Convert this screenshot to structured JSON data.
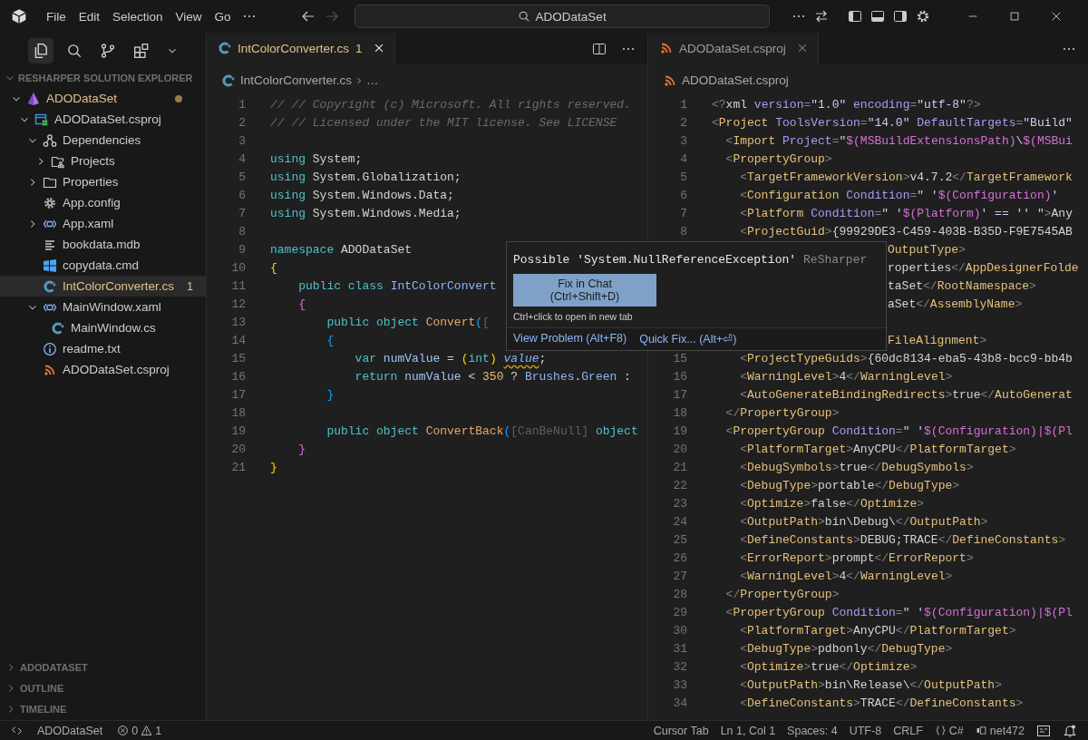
{
  "title_bar": {
    "menus": [
      "File",
      "Edit",
      "Selection",
      "View",
      "Go"
    ],
    "search": "ADODataSet"
  },
  "sidebar": {
    "views": [
      {
        "kind": "explorer",
        "selected": true
      },
      {
        "kind": "search",
        "selected": false
      },
      {
        "kind": "source-control",
        "selected": false
      },
      {
        "kind": "extensions",
        "selected": false
      }
    ],
    "title": "RESHARPER SOLUTION EXPLORER",
    "tree": [
      {
        "label": "ADODataSet",
        "kind": "solution",
        "expanded": true,
        "warning": true,
        "modified": true,
        "selected": false,
        "children": [
          {
            "label": "ADODataSet.csproj",
            "kind": "csproj",
            "expanded": true,
            "warning": false,
            "selected": false,
            "children": [
              {
                "label": "Dependencies",
                "kind": "deps",
                "expanded": true,
                "warning": false,
                "selected": false,
                "children": [
                  {
                    "label": "Projects",
                    "kind": "projects",
                    "expanded": false,
                    "warning": false,
                    "selected": false
                  }
                ]
              },
              {
                "label": "Properties",
                "kind": "folder",
                "expanded": false,
                "warning": false,
                "selected": false
              },
              {
                "label": "App.config",
                "kind": "gear",
                "warning": false,
                "selected": false
              },
              {
                "label": "App.xaml",
                "kind": "xaml",
                "expanded": false,
                "warning": false,
                "selected": false
              },
              {
                "label": "bookdata.mdb",
                "kind": "lines",
                "warning": false,
                "selected": false
              },
              {
                "label": "copydata.cmd",
                "kind": "windows",
                "warning": false,
                "selected": false
              },
              {
                "label": "IntColorConverter.cs",
                "kind": "cs",
                "warning": true,
                "badge": "1",
                "selected": true
              },
              {
                "label": "MainWindow.xaml",
                "kind": "xaml",
                "expanded": true,
                "warning": false,
                "selected": false,
                "children": [
                  {
                    "label": "MainWindow.cs",
                    "kind": "cs",
                    "warning": false,
                    "selected": false
                  }
                ]
              },
              {
                "label": "readme.txt",
                "kind": "info",
                "warning": false,
                "selected": false
              },
              {
                "label": "ADODataSet.csproj",
                "kind": "rss",
                "warning": false,
                "selected": false
              }
            ]
          }
        ]
      }
    ],
    "panels": [
      {
        "title": "ADODATASET",
        "expanded": false
      },
      {
        "title": "OUTLINE",
        "expanded": false
      },
      {
        "title": "TIMELINE",
        "expanded": false
      }
    ]
  },
  "editors": [
    {
      "focused": true,
      "tabs": [
        {
          "label": "IntColorConverter.cs",
          "kind": "cs",
          "badge": "1",
          "warning": true,
          "selected": true
        }
      ],
      "breadcrumb": {
        "kind": "cs",
        "parts": [
          "IntColorConverter.cs",
          "…"
        ]
      },
      "lines": [
        {
          "number": "1",
          "tokens": [
            {
              "kind": "comment",
              "text": "// // Copyright (c) Microsoft. All rights reserved."
            }
          ]
        },
        {
          "number": "2",
          "tokens": [
            {
              "kind": "comment",
              "text": "// // Licensed under the MIT license. See LICENSE"
            }
          ]
        },
        {
          "number": "3"
        },
        {
          "number": "4",
          "tokens": [
            {
              "kind": "kw",
              "text": "using"
            },
            {
              "kind": "text",
              "text": " System;"
            }
          ]
        },
        {
          "number": "5",
          "tokens": [
            {
              "kind": "kw",
              "text": "using"
            },
            {
              "kind": "text",
              "text": " System.Globalization;"
            }
          ]
        },
        {
          "number": "6",
          "tokens": [
            {
              "kind": "kw",
              "text": "using"
            },
            {
              "kind": "text",
              "text": " System.Windows.Data;"
            }
          ]
        },
        {
          "number": "7",
          "tokens": [
            {
              "kind": "kw",
              "text": "using"
            },
            {
              "kind": "text",
              "text": " System.Windows.Media;"
            }
          ]
        },
        {
          "number": "8"
        },
        {
          "number": "9",
          "tokens": [
            {
              "kind": "kw",
              "text": "namespace"
            },
            {
              "kind": "text",
              "text": " ADODataSet"
            }
          ]
        },
        {
          "number": "10",
          "tokens": [
            {
              "kind": "brace1",
              "text": "{"
            }
          ]
        },
        {
          "number": "11",
          "tokens": [
            {
              "kind": "kw",
              "text": "    public class "
            },
            {
              "kind": "type",
              "text": "IntColorConvert"
            }
          ]
        },
        {
          "number": "12",
          "tokens": [
            {
              "kind": "brace2",
              "text": "    {"
            }
          ]
        },
        {
          "number": "13",
          "tokens": [
            {
              "kind": "kw",
              "text": "        public object "
            },
            {
              "kind": "method",
              "text": "Convert"
            },
            {
              "kind": "brace3",
              "text": "("
            },
            {
              "kind": "attr",
              "text": "["
            }
          ]
        },
        {
          "number": "14",
          "tokens": [
            {
              "kind": "brace3",
              "text": "        {"
            }
          ]
        },
        {
          "number": "15",
          "tokens": [
            {
              "kind": "kw",
              "text": "            var "
            },
            {
              "kind": "ident",
              "text": "numValue"
            },
            {
              "kind": "text",
              "text": " = "
            },
            {
              "kind": "brace1",
              "text": "("
            },
            {
              "kind": "kw",
              "text": "int"
            },
            {
              "kind": "brace1",
              "text": ") "
            },
            {
              "kind": "warn",
              "text": "value"
            },
            {
              "kind": "text",
              "text": ";"
            }
          ]
        },
        {
          "number": "16",
          "tokens": [
            {
              "kind": "kw",
              "text": "            return "
            },
            {
              "kind": "ident",
              "text": "numValue"
            },
            {
              "kind": "text",
              "text": " < "
            },
            {
              "kind": "num",
              "text": "350"
            },
            {
              "kind": "text",
              "text": " ? "
            },
            {
              "kind": "type",
              "text": "Brushes"
            },
            {
              "kind": "text",
              "text": "."
            },
            {
              "kind": "type",
              "text": "Green"
            },
            {
              "kind": "text",
              "text": " :"
            }
          ]
        },
        {
          "number": "17",
          "tokens": [
            {
              "kind": "brace3",
              "text": "        }"
            }
          ]
        },
        {
          "number": "18"
        },
        {
          "number": "19",
          "tokens": [
            {
              "kind": "kw",
              "text": "        public object "
            },
            {
              "kind": "method",
              "text": "ConvertBack"
            },
            {
              "kind": "brace3",
              "text": "("
            },
            {
              "kind": "attr",
              "text": "[CanBeNull]"
            },
            {
              "kind": "kw",
              "text": " object"
            }
          ]
        },
        {
          "number": "20",
          "tokens": [
            {
              "kind": "brace2",
              "text": "    }"
            }
          ]
        },
        {
          "number": "21",
          "tokens": [
            {
              "kind": "brace1",
              "text": "}"
            }
          ]
        }
      ]
    },
    {
      "focused": false,
      "tabs": [
        {
          "label": "ADODataSet.csproj",
          "kind": "rss",
          "warning": false,
          "selected": true
        }
      ],
      "breadcrumb": {
        "kind": "rss",
        "parts": [
          "ADODataSet.csproj"
        ]
      },
      "lines": [
        {
          "number": "1",
          "tokens": [
            {
              "kind": "punct",
              "text": "<?"
            },
            {
              "kind": "text",
              "text": "xml "
            },
            {
              "kind": "attr",
              "text": "version"
            },
            {
              "kind": "punct",
              "text": "="
            },
            {
              "kind": "value",
              "text": "\"1.0\""
            },
            {
              "kind": "attr",
              "text": " encoding"
            },
            {
              "kind": "punct",
              "text": "="
            },
            {
              "kind": "value",
              "text": "\"utf-8\""
            },
            {
              "kind": "punct",
              "text": "?>"
            }
          ]
        },
        {
          "number": "2",
          "tokens": [
            {
              "kind": "punct",
              "text": "<"
            },
            {
              "kind": "tag",
              "text": "Project"
            },
            {
              "kind": "attr",
              "text": " ToolsVersion"
            },
            {
              "kind": "punct",
              "text": "="
            },
            {
              "kind": "value",
              "text": "\"14.0\""
            },
            {
              "kind": "attr",
              "text": " DefaultTargets"
            },
            {
              "kind": "punct",
              "text": "="
            },
            {
              "kind": "value",
              "text": "\"Build\""
            }
          ]
        },
        {
          "number": "3",
          "tokens": [
            {
              "kind": "punct",
              "text": "  <"
            },
            {
              "kind": "tag",
              "text": "Import"
            },
            {
              "kind": "attr",
              "text": " Project"
            },
            {
              "kind": "punct",
              "text": "="
            },
            {
              "kind": "value",
              "text": "\""
            },
            {
              "kind": "var",
              "text": "$(MSBuildExtensionsPath)"
            },
            {
              "kind": "value",
              "text": "\\"
            },
            {
              "kind": "var",
              "text": "$(MSBui"
            }
          ]
        },
        {
          "number": "4",
          "tokens": [
            {
              "kind": "punct",
              "text": "  <"
            },
            {
              "kind": "tag",
              "text": "PropertyGroup"
            },
            {
              "kind": "punct",
              "text": ">"
            }
          ]
        },
        {
          "number": "5",
          "tokens": [
            {
              "kind": "punct",
              "text": "    <"
            },
            {
              "kind": "tag",
              "text": "TargetFrameworkVersion"
            },
            {
              "kind": "punct",
              "text": ">"
            },
            {
              "kind": "text",
              "text": "v4.7.2"
            },
            {
              "kind": "punct",
              "text": "</"
            },
            {
              "kind": "tag",
              "text": "TargetFramework"
            }
          ]
        },
        {
          "number": "6",
          "tokens": [
            {
              "kind": "punct",
              "text": "    <"
            },
            {
              "kind": "tag",
              "text": "Configuration"
            },
            {
              "kind": "attr",
              "text": " Condition"
            },
            {
              "kind": "punct",
              "text": "="
            },
            {
              "kind": "value",
              "text": "\" '"
            },
            {
              "kind": "var",
              "text": "$(Configuration)"
            },
            {
              "kind": "value",
              "text": "'"
            }
          ]
        },
        {
          "number": "7",
          "tokens": [
            {
              "kind": "punct",
              "text": "    <"
            },
            {
              "kind": "tag",
              "text": "Platform"
            },
            {
              "kind": "attr",
              "text": " Condition"
            },
            {
              "kind": "punct",
              "text": "="
            },
            {
              "kind": "value",
              "text": "\" '"
            },
            {
              "kind": "var",
              "text": "$(Platform)"
            },
            {
              "kind": "value",
              "text": "' == '' \""
            },
            {
              "kind": "punct",
              "text": ">"
            },
            {
              "kind": "text",
              "text": "Any"
            }
          ]
        },
        {
          "number": "8",
          "tokens": [
            {
              "kind": "punct",
              "text": "    <"
            },
            {
              "kind": "tag",
              "text": "ProjectGuid"
            },
            {
              "kind": "punct",
              "text": ">"
            },
            {
              "kind": "text",
              "text": "{99929DE3-C459-403B-B35D-F9E7545AB"
            }
          ]
        },
        {
          "tokens": [
            {
              "kind": "tag",
              "text": "OutputType"
            },
            {
              "kind": "punct",
              "text": ">"
            }
          ]
        },
        {
          "tokens": [
            {
              "kind": "text",
              "text": "roperties"
            },
            {
              "kind": "punct",
              "text": "</"
            },
            {
              "kind": "tag",
              "text": "AppDesignerFolde"
            }
          ]
        },
        {
          "tokens": [
            {
              "kind": "text",
              "text": "taSet"
            },
            {
              "kind": "punct",
              "text": "</"
            },
            {
              "kind": "tag",
              "text": "RootNamespace"
            },
            {
              "kind": "punct",
              "text": ">"
            }
          ]
        },
        {
          "tokens": [
            {
              "kind": "text",
              "text": "aSet"
            },
            {
              "kind": "punct",
              "text": "</"
            },
            {
              "kind": "tag",
              "text": "AssemblyName"
            },
            {
              "kind": "punct",
              "text": ">"
            }
          ]
        },
        {
          "tokens": [
            {
              "kind": "tag",
              "text": "\nFileAlignment"
            },
            {
              "kind": "punct",
              "text": ">"
            }
          ]
        },
        {
          "number": "15",
          "tokens": [
            {
              "kind": "punct",
              "text": "    <"
            },
            {
              "kind": "tag",
              "text": "ProjectTypeGuids"
            },
            {
              "kind": "punct",
              "text": ">"
            },
            {
              "kind": "text",
              "text": "{60dc8134-eba5-43b8-bcc9-bb4b"
            }
          ]
        },
        {
          "number": "16",
          "tokens": [
            {
              "kind": "punct",
              "text": "    <"
            },
            {
              "kind": "tag",
              "text": "WarningLevel"
            },
            {
              "kind": "punct",
              "text": ">"
            },
            {
              "kind": "text",
              "text": "4"
            },
            {
              "kind": "punct",
              "text": "</"
            },
            {
              "kind": "tag",
              "text": "WarningLevel"
            },
            {
              "kind": "punct",
              "text": ">"
            }
          ]
        },
        {
          "number": "17",
          "tokens": [
            {
              "kind": "punct",
              "text": "    <"
            },
            {
              "kind": "tag",
              "text": "AutoGenerateBindingRedirects"
            },
            {
              "kind": "punct",
              "text": ">"
            },
            {
              "kind": "text",
              "text": "true"
            },
            {
              "kind": "punct",
              "text": "</"
            },
            {
              "kind": "tag",
              "text": "AutoGenerat"
            }
          ]
        },
        {
          "number": "18",
          "tokens": [
            {
              "kind": "punct",
              "text": "  </"
            },
            {
              "kind": "tag",
              "text": "PropertyGroup"
            },
            {
              "kind": "punct",
              "text": ">"
            }
          ]
        },
        {
          "number": "19",
          "tokens": [
            {
              "kind": "punct",
              "text": "  <"
            },
            {
              "kind": "tag",
              "text": "PropertyGroup"
            },
            {
              "kind": "attr",
              "text": " Condition"
            },
            {
              "kind": "punct",
              "text": "="
            },
            {
              "kind": "value",
              "text": "\" '"
            },
            {
              "kind": "var",
              "text": "$(Configuration)|$(Pl"
            }
          ]
        },
        {
          "number": "20",
          "tokens": [
            {
              "kind": "punct",
              "text": "    <"
            },
            {
              "kind": "tag",
              "text": "PlatformTarget"
            },
            {
              "kind": "punct",
              "text": ">"
            },
            {
              "kind": "text",
              "text": "AnyCPU"
            },
            {
              "kind": "punct",
              "text": "</"
            },
            {
              "kind": "tag",
              "text": "PlatformTarget"
            },
            {
              "kind": "punct",
              "text": ">"
            }
          ]
        },
        {
          "number": "21",
          "tokens": [
            {
              "kind": "punct",
              "text": "    <"
            },
            {
              "kind": "tag",
              "text": "DebugSymbols"
            },
            {
              "kind": "punct",
              "text": ">"
            },
            {
              "kind": "text",
              "text": "true"
            },
            {
              "kind": "punct",
              "text": "</"
            },
            {
              "kind": "tag",
              "text": "DebugSymbols"
            },
            {
              "kind": "punct",
              "text": ">"
            }
          ]
        },
        {
          "number": "22",
          "tokens": [
            {
              "kind": "punct",
              "text": "    <"
            },
            {
              "kind": "tag",
              "text": "DebugType"
            },
            {
              "kind": "punct",
              "text": ">"
            },
            {
              "kind": "text",
              "text": "portable"
            },
            {
              "kind": "punct",
              "text": "</"
            },
            {
              "kind": "tag",
              "text": "DebugType"
            },
            {
              "kind": "punct",
              "text": ">"
            }
          ]
        },
        {
          "number": "23",
          "tokens": [
            {
              "kind": "punct",
              "text": "    <"
            },
            {
              "kind": "tag",
              "text": "Optimize"
            },
            {
              "kind": "punct",
              "text": ">"
            },
            {
              "kind": "text",
              "text": "false"
            },
            {
              "kind": "punct",
              "text": "</"
            },
            {
              "kind": "tag",
              "text": "Optimize"
            },
            {
              "kind": "punct",
              "text": ">"
            }
          ]
        },
        {
          "number": "24",
          "tokens": [
            {
              "kind": "punct",
              "text": "    <"
            },
            {
              "kind": "tag",
              "text": "OutputPath"
            },
            {
              "kind": "punct",
              "text": ">"
            },
            {
              "kind": "text",
              "text": "bin\\Debug\\"
            },
            {
              "kind": "punct",
              "text": "</"
            },
            {
              "kind": "tag",
              "text": "OutputPath"
            },
            {
              "kind": "punct",
              "text": ">"
            }
          ]
        },
        {
          "number": "25",
          "tokens": [
            {
              "kind": "punct",
              "text": "    <"
            },
            {
              "kind": "tag",
              "text": "DefineConstants"
            },
            {
              "kind": "punct",
              "text": ">"
            },
            {
              "kind": "text",
              "text": "DEBUG;TRACE"
            },
            {
              "kind": "punct",
              "text": "</"
            },
            {
              "kind": "tag",
              "text": "DefineConstants"
            },
            {
              "kind": "punct",
              "text": ">"
            }
          ]
        },
        {
          "number": "26",
          "tokens": [
            {
              "kind": "punct",
              "text": "    <"
            },
            {
              "kind": "tag",
              "text": "ErrorReport"
            },
            {
              "kind": "punct",
              "text": ">"
            },
            {
              "kind": "text",
              "text": "prompt"
            },
            {
              "kind": "punct",
              "text": "</"
            },
            {
              "kind": "tag",
              "text": "ErrorReport"
            },
            {
              "kind": "punct",
              "text": ">"
            }
          ]
        },
        {
          "number": "27",
          "tokens": [
            {
              "kind": "punct",
              "text": "    <"
            },
            {
              "kind": "tag",
              "text": "WarningLevel"
            },
            {
              "kind": "punct",
              "text": ">"
            },
            {
              "kind": "text",
              "text": "4"
            },
            {
              "kind": "punct",
              "text": "</"
            },
            {
              "kind": "tag",
              "text": "WarningLevel"
            },
            {
              "kind": "punct",
              "text": ">"
            }
          ]
        },
        {
          "number": "28",
          "tokens": [
            {
              "kind": "punct",
              "text": "  </"
            },
            {
              "kind": "tag",
              "text": "PropertyGroup"
            },
            {
              "kind": "punct",
              "text": ">"
            }
          ]
        },
        {
          "number": "29",
          "tokens": [
            {
              "kind": "punct",
              "text": "  <"
            },
            {
              "kind": "tag",
              "text": "PropertyGroup"
            },
            {
              "kind": "attr",
              "text": " Condition"
            },
            {
              "kind": "punct",
              "text": "="
            },
            {
              "kind": "value",
              "text": "\" '"
            },
            {
              "kind": "var",
              "text": "$(Configuration)|$(Pl"
            }
          ]
        },
        {
          "number": "30",
          "tokens": [
            {
              "kind": "punct",
              "text": "    <"
            },
            {
              "kind": "tag",
              "text": "PlatformTarget"
            },
            {
              "kind": "punct",
              "text": ">"
            },
            {
              "kind": "text",
              "text": "AnyCPU"
            },
            {
              "kind": "punct",
              "text": "</"
            },
            {
              "kind": "tag",
              "text": "PlatformTarget"
            },
            {
              "kind": "punct",
              "text": ">"
            }
          ]
        },
        {
          "number": "31",
          "tokens": [
            {
              "kind": "punct",
              "text": "    <"
            },
            {
              "kind": "tag",
              "text": "DebugType"
            },
            {
              "kind": "punct",
              "text": ">"
            },
            {
              "kind": "text",
              "text": "pdbonly"
            },
            {
              "kind": "punct",
              "text": "</"
            },
            {
              "kind": "tag",
              "text": "DebugType"
            },
            {
              "kind": "punct",
              "text": ">"
            }
          ]
        },
        {
          "number": "32",
          "tokens": [
            {
              "kind": "punct",
              "text": "    <"
            },
            {
              "kind": "tag",
              "text": "Optimize"
            },
            {
              "kind": "punct",
              "text": ">"
            },
            {
              "kind": "text",
              "text": "true"
            },
            {
              "kind": "punct",
              "text": "</"
            },
            {
              "kind": "tag",
              "text": "Optimize"
            },
            {
              "kind": "punct",
              "text": ">"
            }
          ]
        },
        {
          "number": "33",
          "tokens": [
            {
              "kind": "punct",
              "text": "    <"
            },
            {
              "kind": "tag",
              "text": "OutputPath"
            },
            {
              "kind": "punct",
              "text": ">"
            },
            {
              "kind": "text",
              "text": "bin\\Release\\"
            },
            {
              "kind": "punct",
              "text": "</"
            },
            {
              "kind": "tag",
              "text": "OutputPath"
            },
            {
              "kind": "punct",
              "text": ">"
            }
          ]
        },
        {
          "number": "34",
          "tokens": [
            {
              "kind": "punct",
              "text": "    <"
            },
            {
              "kind": "tag",
              "text": "DefineConstants"
            },
            {
              "kind": "punct",
              "text": ">"
            },
            {
              "kind": "text",
              "text": "TRACE"
            },
            {
              "kind": "punct",
              "text": "</"
            },
            {
              "kind": "tag",
              "text": "DefineConstants"
            },
            {
              "kind": "punct",
              "text": ">"
            }
          ]
        }
      ]
    }
  ],
  "popup": {
    "message": "Possible 'System.NullReferenceException'",
    "source": "ReSharper",
    "button": {
      "label": "Fix in Chat",
      "shortcut": "(Ctrl+Shift+D)"
    },
    "hint": "Ctrl+click to open in new tab",
    "actions": [
      "View Problem (Alt+F8)",
      "Quick Fix... (Alt+⏎)"
    ]
  },
  "status_bar": {
    "left": [
      {
        "kind": "remote"
      },
      {
        "kind": "text",
        "text": "ADODataSet"
      },
      {
        "kind": "problems",
        "errors": "0",
        "warnings": "1"
      }
    ],
    "right": [
      {
        "kind": "text",
        "text": "Cursor Tab"
      },
      {
        "kind": "text",
        "text": "Ln 1, Col 1"
      },
      {
        "kind": "text",
        "text": "Spaces: 4"
      },
      {
        "kind": "text",
        "text": "UTF-8"
      },
      {
        "kind": "text",
        "text": "CRLF"
      },
      {
        "kind": "language",
        "text": "C#"
      },
      {
        "kind": "framework",
        "text": "net472"
      },
      {
        "kind": "feedback"
      },
      {
        "kind": "bell"
      }
    ]
  }
}
